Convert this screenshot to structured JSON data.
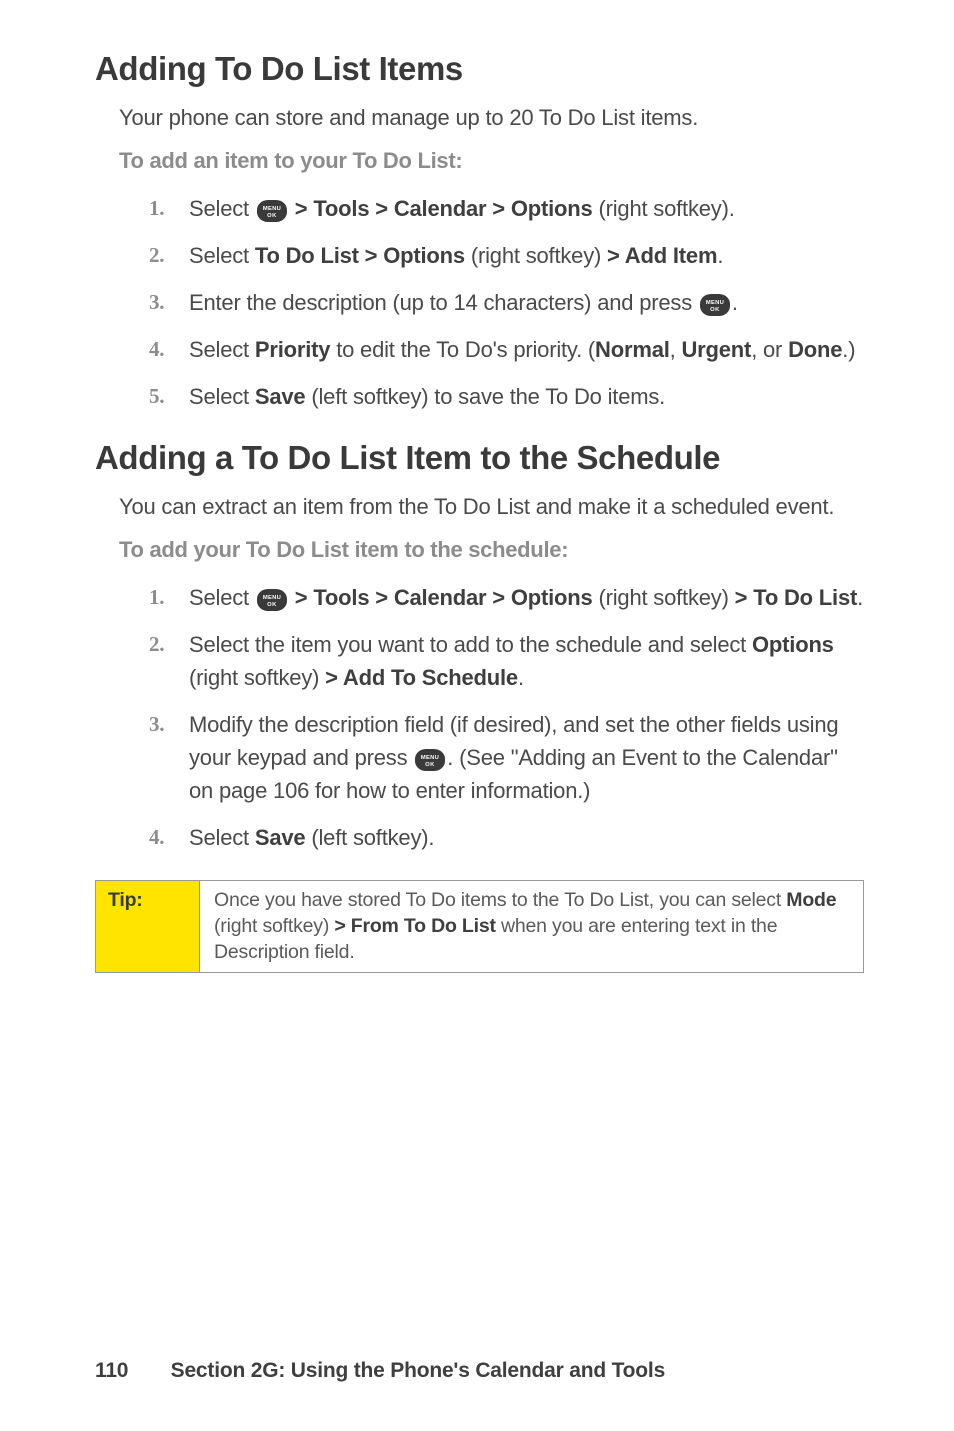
{
  "heading1": "Adding To Do List Items",
  "intro1": "Your phone can store and manage up to 20 To Do List items.",
  "subhead1": "To add an item to your To Do List:",
  "steps1": [
    {
      "num": "1.",
      "pre": "Select ",
      "icon": true,
      "post_parts": [
        {
          "t": " > Tools > Calendar > Options",
          "b": true
        },
        {
          "t": " (right softkey).",
          "b": false
        }
      ]
    },
    {
      "num": "2.",
      "pre": "Select ",
      "icon": false,
      "post_parts": [
        {
          "t": "To Do List > Options",
          "b": true
        },
        {
          "t": " (right softkey) ",
          "b": false
        },
        {
          "t": "> Add Item",
          "b": true
        },
        {
          "t": ".",
          "b": false
        }
      ]
    },
    {
      "num": "3.",
      "pre": "Enter the description (up to 14 characters) and press ",
      "icon": true,
      "post_parts": [
        {
          "t": ".",
          "b": false
        }
      ]
    },
    {
      "num": "4.",
      "pre": "Select ",
      "icon": false,
      "post_parts": [
        {
          "t": "Priority",
          "b": true
        },
        {
          "t": " to edit the To Do's priority. (",
          "b": false
        },
        {
          "t": "Normal",
          "b": true
        },
        {
          "t": ", ",
          "b": false
        },
        {
          "t": "Urgent",
          "b": true
        },
        {
          "t": ", or ",
          "b": false
        },
        {
          "t": "Done",
          "b": true
        },
        {
          "t": ".)",
          "b": false
        }
      ]
    },
    {
      "num": "5.",
      "pre": "Select ",
      "icon": false,
      "post_parts": [
        {
          "t": "Save",
          "b": true
        },
        {
          "t": " (left softkey) to save the To Do items.",
          "b": false
        }
      ]
    }
  ],
  "heading2": "Adding a To Do List Item to the Schedule",
  "intro2": "You can extract an item from the To Do List and make it a scheduled event.",
  "subhead2": "To add your To Do List item to the schedule:",
  "steps2": [
    {
      "num": "1.",
      "pre": "Select ",
      "icon": true,
      "post_parts": [
        {
          "t": " > Tools > Calendar > Options",
          "b": true
        },
        {
          "t": " (right softkey) ",
          "b": false
        },
        {
          "t": "> To Do List",
          "b": true
        },
        {
          "t": ".",
          "b": false
        }
      ]
    },
    {
      "num": "2.",
      "pre": "Select the item you want to add to the schedule and select ",
      "icon": false,
      "post_parts": [
        {
          "t": "Options",
          "b": true
        },
        {
          "t": " (right softkey) ",
          "b": false
        },
        {
          "t": "> Add To Schedule",
          "b": true
        },
        {
          "t": ".",
          "b": false
        }
      ]
    },
    {
      "num": "3.",
      "pre": "Modify the description field (if desired), and set the other fields using your keypad and press ",
      "icon": true,
      "post_parts": [
        {
          "t": ". (See \"Adding an Event to the Calendar\" on page 106 for how to enter information.)",
          "b": false
        }
      ]
    },
    {
      "num": "4.",
      "pre": "Select ",
      "icon": false,
      "post_parts": [
        {
          "t": "Save",
          "b": true
        },
        {
          "t": " (left softkey).",
          "b": false
        }
      ]
    }
  ],
  "tip": {
    "label": "Tip:",
    "parts": [
      {
        "t": "Once you have stored To Do items to the To Do List, you can select ",
        "b": false
      },
      {
        "t": "Mode",
        "b": true
      },
      {
        "t": " (right softkey) ",
        "b": false
      },
      {
        "t": "> From To Do List",
        "b": true
      },
      {
        "t": " when you are entering text in the Description field.",
        "b": false
      }
    ]
  },
  "footer": {
    "page": "110",
    "title": "Section 2G: Using the Phone's Calendar and Tools"
  }
}
